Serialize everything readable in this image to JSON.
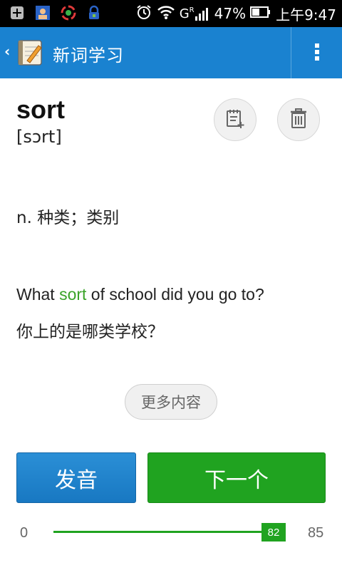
{
  "status_bar": {
    "signal_label": "G",
    "signal_sup": "R",
    "battery": "47%",
    "time": "上午9:47",
    "icons": [
      "plus-square-icon",
      "contact-card-icon",
      "sync-circle-icon",
      "alarm-lock-icon",
      "alarm-clock-icon",
      "wifi-icon",
      "cell-signal-icon",
      "battery-icon"
    ]
  },
  "action_bar": {
    "title": "新词学习",
    "back_icon": "chevron-left-icon",
    "logo_icon": "words-notebook-icon",
    "menu_icon": "overflow-menu-icon",
    "color": "#1a82d0"
  },
  "card": {
    "word": "sort",
    "phonetic": "[sɔrt]",
    "definition": "n. 种类；类别",
    "example": {
      "before": "What ",
      "highlight": "sort",
      "after": " of school did you go to?"
    },
    "translation": "你上的是哪类学校？",
    "more_label": "更多内容",
    "highlight_color": "#3aa328"
  },
  "actions": {
    "add_note_icon": "add-to-notebook-icon",
    "delete_icon": "trash-icon",
    "sound_label": "发音",
    "next_label": "下一个"
  },
  "progress": {
    "min": "0",
    "max": "85",
    "current": "82",
    "value": 82,
    "total": 85,
    "color": "#20a320"
  }
}
